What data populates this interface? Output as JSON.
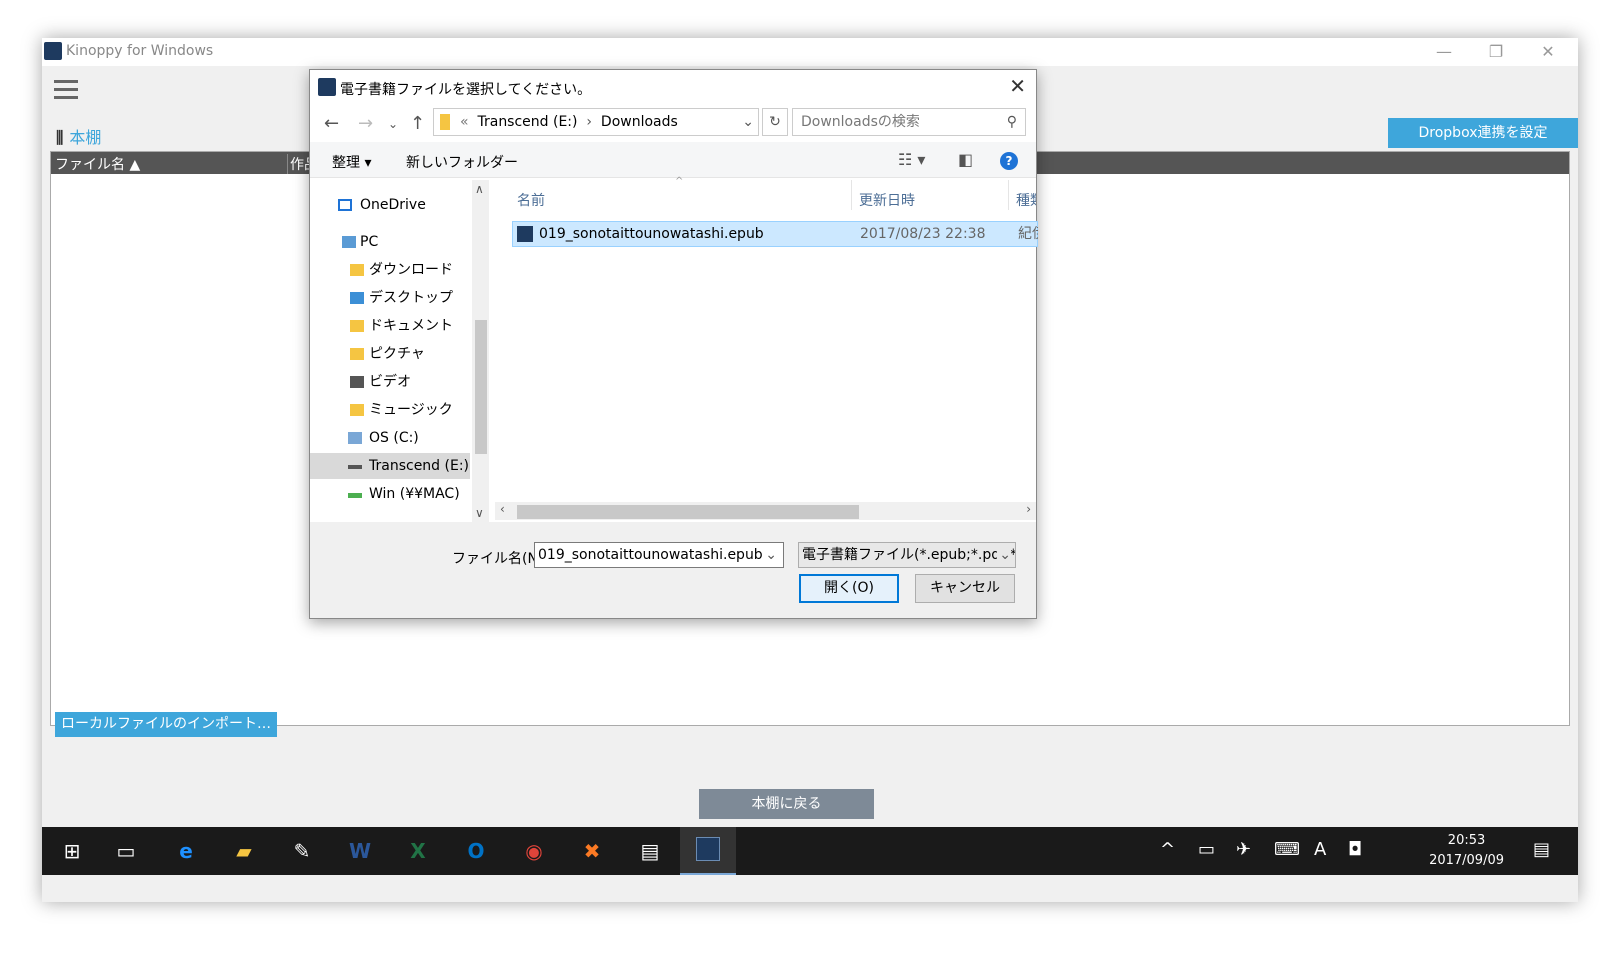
{
  "app": {
    "title": "Kinoppy for Windows",
    "shelf_label": "本棚",
    "dropbox_button": "Dropbox連携を設定",
    "table_headers": [
      "ファイル名 ▲",
      "作品"
    ],
    "import_button": "ローカルファイルのインポート…",
    "back_button": "本棚に戻る",
    "window_controls": [
      "—",
      "❐",
      "✕"
    ]
  },
  "dialog": {
    "title": "電子書籍ファイルを選択してください。",
    "address": {
      "prefix": "«",
      "crumbs": [
        "Transcend (E:)",
        "Downloads"
      ]
    },
    "search_placeholder": "Downloadsの検索",
    "commands": {
      "organize": "整理 ▾",
      "new_folder": "新しいフォルダー",
      "help": "?"
    },
    "nav_items": [
      {
        "label": "OneDrive",
        "icon": "onedrive-icon"
      },
      {
        "label": "PC",
        "icon": "pc-icon"
      },
      {
        "label": "ダウンロード",
        "icon": "downloads-folder-icon"
      },
      {
        "label": "デスクトップ",
        "icon": "desktop-folder-icon"
      },
      {
        "label": "ドキュメント",
        "icon": "documents-folder-icon"
      },
      {
        "label": "ピクチャ",
        "icon": "pictures-folder-icon"
      },
      {
        "label": "ビデオ",
        "icon": "videos-folder-icon"
      },
      {
        "label": "ミュージック",
        "icon": "music-folder-icon"
      },
      {
        "label": "OS (C:)",
        "icon": "drive-icon"
      },
      {
        "label": "Transcend (E:)",
        "icon": "usb-drive-icon"
      },
      {
        "label": "Win (¥¥MAC)",
        "icon": "network-drive-icon"
      }
    ],
    "selected_nav": "Transcend (E:)",
    "columns": [
      "名前",
      "更新日時",
      "種類"
    ],
    "files": [
      {
        "name": "019_sonotaittounowatashi.epub",
        "modified": "2017/08/23 22:38",
        "type": "紀伊"
      }
    ],
    "filename_label": "ファイル名(N):",
    "filename_value": "019_sonotaittounowatashi.epub",
    "filetype_value": "電子書籍ファイル(*.epub;*.pdf;*.b",
    "open_button": "開く(O)",
    "cancel_button": "キャンセル"
  },
  "taskbar": {
    "time": "20:53",
    "date": "2017/09/09",
    "ime": "A"
  },
  "colors": {
    "accent": "#3ea6db",
    "selection": "#cce8ff",
    "taskbar": "#1a1a1a"
  }
}
